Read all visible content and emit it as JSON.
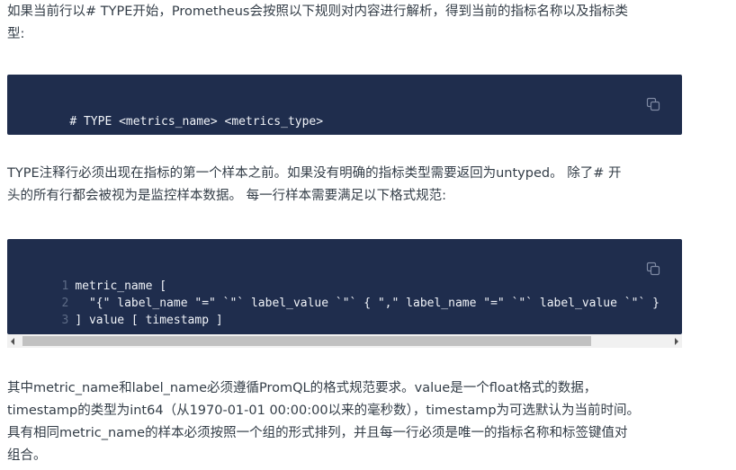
{
  "para1": {
    "line1": "如果当前行以# TYPE开始，Prometheus会按照以下规则对内容进行解析，得到当前的指标名称以及指标类",
    "line2": "型:"
  },
  "code1": {
    "text": "# TYPE <metrics_name> <metrics_type>",
    "copy_icon": "copy-icon"
  },
  "para2": {
    "line1": "TYPE注释行必须出现在指标的第一个样本之前。如果没有明确的指标类型需要返回为untyped。 除了# 开",
    "line2": "头的所有行都会被视为是监控样本数据。 每一行样本需要满足以下格式规范:"
  },
  "code2": {
    "lines": [
      {
        "num": "1",
        "text": "metric_name ["
      },
      {
        "num": "2",
        "text": "  \"{\" label_name \"=\" `\"` label_value `\"` { \",\" label_name \"=\" `\"` label_value `\"` }"
      },
      {
        "num": "3",
        "text": "] value [ timestamp ]"
      }
    ],
    "copy_icon": "copy-icon"
  },
  "para3": {
    "line1": "其中metric_name和label_name必须遵循PromQL的格式规范要求。value是一个float格式的数据，",
    "line2": "timestamp的类型为int64（从1970-01-01 00:00:00以来的毫秒数），timestamp为可选默认为当前时间。",
    "line3": "具有相同metric_name的样本必须按照一个组的形式排列，并且每一行必须是唯一的指标名称和标签键值对",
    "line4": "组合。"
  }
}
